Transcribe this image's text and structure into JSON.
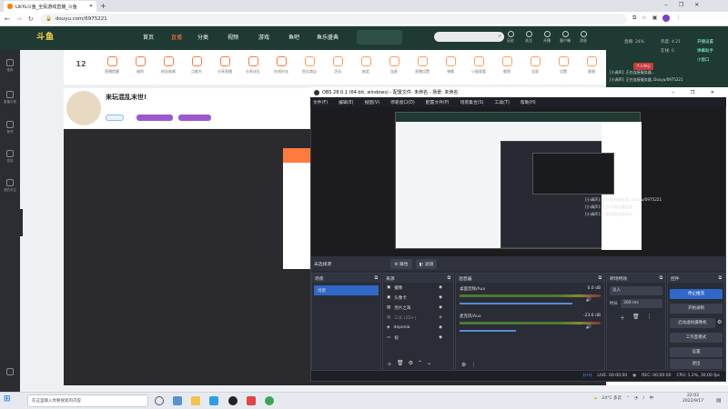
{
  "browser": {
    "tab_title": "LikYu斗鱼_全民游戏直播_斗鱼",
    "url": "douyu.com/6975221"
  },
  "douyu": {
    "logo": "斗鱼",
    "nav": [
      "首页",
      "直播",
      "分类",
      "视频",
      "游戏",
      "鱼吧",
      "鱼乐盛典"
    ],
    "user_icons": [
      "历史",
      "关注",
      "开播",
      "客户端",
      "消息"
    ],
    "promo": "来玩混乱末世!",
    "level_number": "12",
    "sidebar": [
      "推荐",
      "直播分类",
      "鱼吧",
      "发现",
      "我的关注"
    ],
    "toolbar_items": [
      "直播提醒",
      "福利",
      "粉丝勋章",
      "点歌台",
      "分享直播",
      "分享送礼",
      "在线时长",
      "鱼丸商店",
      "活动",
      "抽奖",
      "连麦",
      "直播设置",
      "弹幕",
      "小窗观看",
      "截图",
      "全屏",
      "设置",
      "客服"
    ],
    "right_stats": [
      "直播: 24%",
      "热度: 4.21",
      "在线: 0"
    ],
    "right_actions": [
      "开播设置",
      "弹幕助手",
      "小窗口"
    ],
    "right_tag": "个人中心",
    "right_messages": [
      "[小调声]: 正在连接服务器...",
      "[小调声]: 正在连接服务器..Douyu/6975221",
      "[小调声]: 正在与服务器连接",
      "[小调声]: 与服务器连接成功"
    ],
    "preview_messages": [
      "[小调声]: 正在连接服务器..Douyu/6975221",
      "[小调声]: 正在与服务器连接",
      "[小调声]: 与服务器连接成功"
    ]
  },
  "obs": {
    "title": "OBS 28.0.1 (64-bit, windows) - 配置文件: 未命名 - 场景: 未命名",
    "menu": [
      "文件(F)",
      "编辑(E)",
      "视图(V)",
      "停靠窗口(D)",
      "配置文件(P)",
      "场景集合(S)",
      "工具(T)",
      "帮助(H)"
    ],
    "no_source": "未选择源",
    "props_btn": "属性",
    "filters_btn": "滤镜",
    "docks": {
      "scenes": {
        "title": "场景",
        "items": [
          "场景"
        ]
      },
      "sources": {
        "title": "来源",
        "items": [
          "摄像",
          "头像卡",
          "亮片之海",
          "三天 (2D+)",
          "deponia",
          "视"
        ]
      },
      "mixer": {
        "title": "混音器",
        "channels": [
          {
            "name": "桌面音频/Aux",
            "db": "0.0 dB"
          },
          {
            "name": "麦克风/Aux",
            "db": "-23.6 dB"
          }
        ]
      },
      "transitions": {
        "title": "转场特效",
        "type": "淡入",
        "duration_label": "时长",
        "duration": "300 ms"
      },
      "controls": {
        "title": "控件",
        "buttons": [
          "停止推流",
          "开始录制",
          "启动虚拟摄像机",
          "工作室模式",
          "设置",
          "退出"
        ]
      }
    },
    "status": {
      "live": "LIVE: 00:00:00",
      "rec": "REC: 00:00:00",
      "cpu": "CPU: 1.2%, 30.00 fps"
    }
  },
  "taskbar": {
    "search": "在这里输入你要搜索的内容",
    "weather": "24°C 多云",
    "time": "22:03",
    "date": "2022/9/17"
  }
}
